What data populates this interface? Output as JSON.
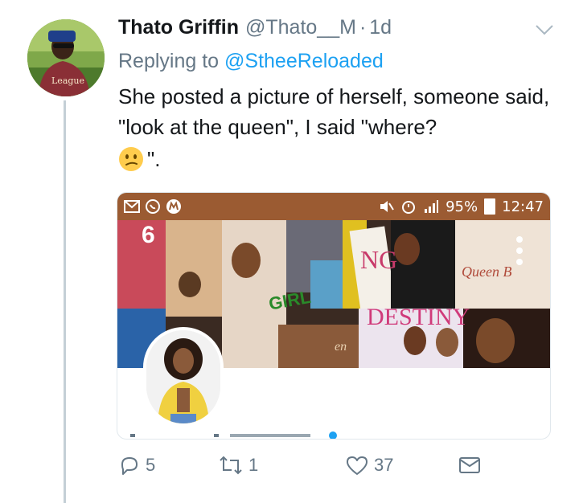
{
  "tweet": {
    "display_name": "Thato Griffin",
    "handle": "@Thato__M",
    "separator": "·",
    "time": "1d",
    "reply_prefix": "Replying to",
    "reply_mention": "@StheeReloaded",
    "text": "She posted a picture of herself, someone said, \"look at the queen\", I said \"where?",
    "text_suffix": "\"."
  },
  "avatar": {
    "shirt_text": "League"
  },
  "card_image": {
    "status_bar": {
      "battery": "95%",
      "clock": "12:47"
    },
    "collage_labels": [
      "GIRL",
      "NG",
      "DESTINY",
      "Queen B",
      "en"
    ]
  },
  "actions": {
    "reply_count": "5",
    "retweet_count": "1",
    "like_count": "37"
  },
  "colors": {
    "accent": "#1da1f2",
    "secondary_text": "#657786",
    "status_bar": "#9b5b32"
  }
}
